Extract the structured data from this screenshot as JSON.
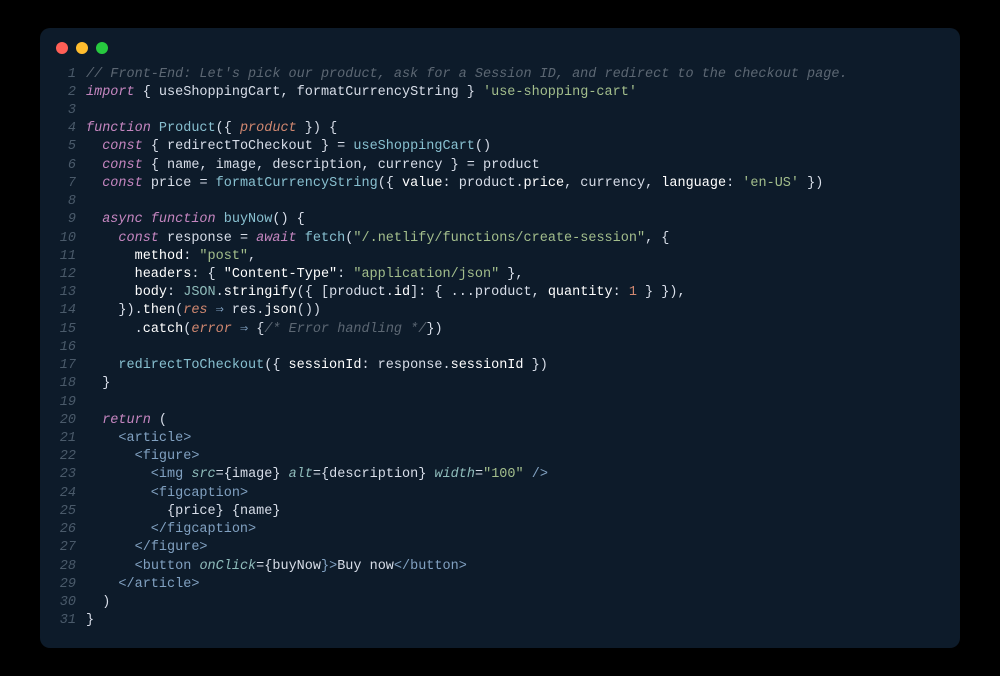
{
  "window": {
    "traffic_lights": [
      "close",
      "minimize",
      "zoom"
    ]
  },
  "code": {
    "lines": [
      {
        "n": 1,
        "tokens": [
          {
            "t": "// Front-End: Let's pick our product, ask for a Session ID, and redirect to the checkout page.",
            "c": "tok-comment"
          }
        ]
      },
      {
        "n": 2,
        "tokens": [
          {
            "t": "import",
            "c": "tok-keyword"
          },
          {
            "t": " { ",
            "c": "tok-punct"
          },
          {
            "t": "useShoppingCart",
            "c": "tok-var"
          },
          {
            "t": ", ",
            "c": "tok-punct"
          },
          {
            "t": "formatCurrencyString",
            "c": "tok-var"
          },
          {
            "t": " } ",
            "c": "tok-punct"
          },
          {
            "t": "'use-shopping-cart'",
            "c": "tok-string"
          }
        ]
      },
      {
        "n": 3,
        "tokens": []
      },
      {
        "n": 4,
        "tokens": [
          {
            "t": "function",
            "c": "tok-keyword"
          },
          {
            "t": " ",
            "c": ""
          },
          {
            "t": "Product",
            "c": "tok-func"
          },
          {
            "t": "({ ",
            "c": "tok-punct"
          },
          {
            "t": "product",
            "c": "tok-param"
          },
          {
            "t": " }) {",
            "c": "tok-punct"
          }
        ]
      },
      {
        "n": 5,
        "tokens": [
          {
            "t": "  ",
            "c": ""
          },
          {
            "t": "const",
            "c": "tok-keyword"
          },
          {
            "t": " { ",
            "c": "tok-punct"
          },
          {
            "t": "redirectToCheckout",
            "c": "tok-var"
          },
          {
            "t": " } = ",
            "c": "tok-punct"
          },
          {
            "t": "useShoppingCart",
            "c": "tok-func"
          },
          {
            "t": "()",
            "c": "tok-punct"
          }
        ]
      },
      {
        "n": 6,
        "tokens": [
          {
            "t": "  ",
            "c": ""
          },
          {
            "t": "const",
            "c": "tok-keyword"
          },
          {
            "t": " { ",
            "c": "tok-punct"
          },
          {
            "t": "name",
            "c": "tok-var"
          },
          {
            "t": ", ",
            "c": "tok-punct"
          },
          {
            "t": "image",
            "c": "tok-var"
          },
          {
            "t": ", ",
            "c": "tok-punct"
          },
          {
            "t": "description",
            "c": "tok-var"
          },
          {
            "t": ", ",
            "c": "tok-punct"
          },
          {
            "t": "currency",
            "c": "tok-var"
          },
          {
            "t": " } = ",
            "c": "tok-punct"
          },
          {
            "t": "product",
            "c": "tok-var"
          }
        ]
      },
      {
        "n": 7,
        "tokens": [
          {
            "t": "  ",
            "c": ""
          },
          {
            "t": "const",
            "c": "tok-keyword"
          },
          {
            "t": " ",
            "c": ""
          },
          {
            "t": "price",
            "c": "tok-var"
          },
          {
            "t": " = ",
            "c": "tok-punct"
          },
          {
            "t": "formatCurrencyString",
            "c": "tok-func"
          },
          {
            "t": "({ ",
            "c": "tok-punct"
          },
          {
            "t": "value",
            "c": "tok-white"
          },
          {
            "t": ": ",
            "c": "tok-punct"
          },
          {
            "t": "product",
            "c": "tok-var"
          },
          {
            "t": ".",
            "c": "tok-punct"
          },
          {
            "t": "price",
            "c": "tok-white"
          },
          {
            "t": ", ",
            "c": "tok-punct"
          },
          {
            "t": "currency",
            "c": "tok-var"
          },
          {
            "t": ", ",
            "c": "tok-punct"
          },
          {
            "t": "language",
            "c": "tok-white"
          },
          {
            "t": ": ",
            "c": "tok-punct"
          },
          {
            "t": "'en-US'",
            "c": "tok-string"
          },
          {
            "t": " })",
            "c": "tok-punct"
          }
        ]
      },
      {
        "n": 8,
        "tokens": []
      },
      {
        "n": 9,
        "tokens": [
          {
            "t": "  ",
            "c": ""
          },
          {
            "t": "async",
            "c": "tok-keyword"
          },
          {
            "t": " ",
            "c": ""
          },
          {
            "t": "function",
            "c": "tok-keyword"
          },
          {
            "t": " ",
            "c": ""
          },
          {
            "t": "buyNow",
            "c": "tok-func"
          },
          {
            "t": "() {",
            "c": "tok-punct"
          }
        ]
      },
      {
        "n": 10,
        "tokens": [
          {
            "t": "    ",
            "c": ""
          },
          {
            "t": "const",
            "c": "tok-keyword"
          },
          {
            "t": " ",
            "c": ""
          },
          {
            "t": "response",
            "c": "tok-var"
          },
          {
            "t": " = ",
            "c": "tok-punct"
          },
          {
            "t": "await",
            "c": "tok-keyword"
          },
          {
            "t": " ",
            "c": ""
          },
          {
            "t": "fetch",
            "c": "tok-func"
          },
          {
            "t": "(",
            "c": "tok-punct"
          },
          {
            "t": "\"/.netlify/functions/create-session\"",
            "c": "tok-string"
          },
          {
            "t": ", {",
            "c": "tok-punct"
          }
        ]
      },
      {
        "n": 11,
        "tokens": [
          {
            "t": "      ",
            "c": ""
          },
          {
            "t": "method",
            "c": "tok-white"
          },
          {
            "t": ": ",
            "c": "tok-punct"
          },
          {
            "t": "\"post\"",
            "c": "tok-string"
          },
          {
            "t": ",",
            "c": "tok-punct"
          }
        ]
      },
      {
        "n": 12,
        "tokens": [
          {
            "t": "      ",
            "c": ""
          },
          {
            "t": "headers",
            "c": "tok-white"
          },
          {
            "t": ": { ",
            "c": "tok-punct"
          },
          {
            "t": "\"Content-Type\"",
            "c": "tok-white"
          },
          {
            "t": ": ",
            "c": "tok-punct"
          },
          {
            "t": "\"application/json\"",
            "c": "tok-string"
          },
          {
            "t": " },",
            "c": "tok-punct"
          }
        ]
      },
      {
        "n": 13,
        "tokens": [
          {
            "t": "      ",
            "c": ""
          },
          {
            "t": "body",
            "c": "tok-white"
          },
          {
            "t": ": ",
            "c": "tok-punct"
          },
          {
            "t": "JSON",
            "c": "tok-type"
          },
          {
            "t": ".",
            "c": "tok-punct"
          },
          {
            "t": "stringify",
            "c": "tok-white"
          },
          {
            "t": "({ [",
            "c": "tok-punct"
          },
          {
            "t": "product",
            "c": "tok-var"
          },
          {
            "t": ".",
            "c": "tok-punct"
          },
          {
            "t": "id",
            "c": "tok-white"
          },
          {
            "t": "]: { ...",
            "c": "tok-punct"
          },
          {
            "t": "product",
            "c": "tok-var"
          },
          {
            "t": ", ",
            "c": "tok-punct"
          },
          {
            "t": "quantity",
            "c": "tok-white"
          },
          {
            "t": ": ",
            "c": "tok-punct"
          },
          {
            "t": "1",
            "c": "tok-number"
          },
          {
            "t": " } }),",
            "c": "tok-punct"
          }
        ]
      },
      {
        "n": 14,
        "tokens": [
          {
            "t": "    }).",
            "c": "tok-punct"
          },
          {
            "t": "then",
            "c": "tok-white"
          },
          {
            "t": "(",
            "c": "tok-punct"
          },
          {
            "t": "res",
            "c": "tok-param"
          },
          {
            "t": " ",
            "c": ""
          },
          {
            "t": "⇒",
            "c": "tok-operator"
          },
          {
            "t": " ",
            "c": ""
          },
          {
            "t": "res",
            "c": "tok-var"
          },
          {
            "t": ".",
            "c": "tok-punct"
          },
          {
            "t": "json",
            "c": "tok-white"
          },
          {
            "t": "())",
            "c": "tok-punct"
          }
        ]
      },
      {
        "n": 15,
        "tokens": [
          {
            "t": "      .",
            "c": "tok-punct"
          },
          {
            "t": "catch",
            "c": "tok-white"
          },
          {
            "t": "(",
            "c": "tok-punct"
          },
          {
            "t": "error",
            "c": "tok-param"
          },
          {
            "t": " ",
            "c": ""
          },
          {
            "t": "⇒",
            "c": "tok-operator"
          },
          {
            "t": " {",
            "c": "tok-punct"
          },
          {
            "t": "/* Error handling */",
            "c": "tok-comment"
          },
          {
            "t": "})",
            "c": "tok-punct"
          }
        ]
      },
      {
        "n": 16,
        "tokens": []
      },
      {
        "n": 17,
        "tokens": [
          {
            "t": "    ",
            "c": ""
          },
          {
            "t": "redirectToCheckout",
            "c": "tok-func"
          },
          {
            "t": "({ ",
            "c": "tok-punct"
          },
          {
            "t": "sessionId",
            "c": "tok-white"
          },
          {
            "t": ": ",
            "c": "tok-punct"
          },
          {
            "t": "response",
            "c": "tok-var"
          },
          {
            "t": ".",
            "c": "tok-punct"
          },
          {
            "t": "sessionId",
            "c": "tok-white"
          },
          {
            "t": " })",
            "c": "tok-punct"
          }
        ]
      },
      {
        "n": 18,
        "tokens": [
          {
            "t": "  }",
            "c": "tok-punct"
          }
        ]
      },
      {
        "n": 19,
        "tokens": []
      },
      {
        "n": 20,
        "tokens": [
          {
            "t": "  ",
            "c": ""
          },
          {
            "t": "return",
            "c": "tok-keyword"
          },
          {
            "t": " (",
            "c": "tok-punct"
          }
        ]
      },
      {
        "n": 21,
        "tokens": [
          {
            "t": "    <",
            "c": "tok-tag"
          },
          {
            "t": "article",
            "c": "tok-tag"
          },
          {
            "t": ">",
            "c": "tok-tag"
          }
        ]
      },
      {
        "n": 22,
        "tokens": [
          {
            "t": "      <",
            "c": "tok-tag"
          },
          {
            "t": "figure",
            "c": "tok-tag"
          },
          {
            "t": ">",
            "c": "tok-tag"
          }
        ]
      },
      {
        "n": 23,
        "tokens": [
          {
            "t": "        <",
            "c": "tok-tag"
          },
          {
            "t": "img",
            "c": "tok-tag"
          },
          {
            "t": " ",
            "c": ""
          },
          {
            "t": "src",
            "c": "tok-attr"
          },
          {
            "t": "=",
            "c": "tok-punct"
          },
          {
            "t": "{",
            "c": "tok-punct"
          },
          {
            "t": "image",
            "c": "tok-var"
          },
          {
            "t": "}",
            "c": "tok-punct"
          },
          {
            "t": " ",
            "c": ""
          },
          {
            "t": "alt",
            "c": "tok-attr"
          },
          {
            "t": "=",
            "c": "tok-punct"
          },
          {
            "t": "{",
            "c": "tok-punct"
          },
          {
            "t": "description",
            "c": "tok-var"
          },
          {
            "t": "}",
            "c": "tok-punct"
          },
          {
            "t": " ",
            "c": ""
          },
          {
            "t": "width",
            "c": "tok-attr"
          },
          {
            "t": "=",
            "c": "tok-punct"
          },
          {
            "t": "\"100\"",
            "c": "tok-string"
          },
          {
            "t": " />",
            "c": "tok-tag"
          }
        ]
      },
      {
        "n": 24,
        "tokens": [
          {
            "t": "        <",
            "c": "tok-tag"
          },
          {
            "t": "figcaption",
            "c": "tok-tag"
          },
          {
            "t": ">",
            "c": "tok-tag"
          }
        ]
      },
      {
        "n": 25,
        "tokens": [
          {
            "t": "          {",
            "c": "tok-punct"
          },
          {
            "t": "price",
            "c": "tok-var"
          },
          {
            "t": "} {",
            "c": "tok-punct"
          },
          {
            "t": "name",
            "c": "tok-var"
          },
          {
            "t": "}",
            "c": "tok-punct"
          }
        ]
      },
      {
        "n": 26,
        "tokens": [
          {
            "t": "        </",
            "c": "tok-tag"
          },
          {
            "t": "figcaption",
            "c": "tok-tag"
          },
          {
            "t": ">",
            "c": "tok-tag"
          }
        ]
      },
      {
        "n": 27,
        "tokens": [
          {
            "t": "      </",
            "c": "tok-tag"
          },
          {
            "t": "figure",
            "c": "tok-tag"
          },
          {
            "t": ">",
            "c": "tok-tag"
          }
        ]
      },
      {
        "n": 28,
        "tokens": [
          {
            "t": "      <",
            "c": "tok-tag"
          },
          {
            "t": "button",
            "c": "tok-tag"
          },
          {
            "t": " ",
            "c": ""
          },
          {
            "t": "onClick",
            "c": "tok-attr"
          },
          {
            "t": "=",
            "c": "tok-punct"
          },
          {
            "t": "{",
            "c": "tok-punct"
          },
          {
            "t": "buyNow",
            "c": "tok-var"
          },
          {
            "t": "}>",
            "c": "tok-tag"
          },
          {
            "t": "Buy now",
            "c": "tok-var"
          },
          {
            "t": "</",
            "c": "tok-tag"
          },
          {
            "t": "button",
            "c": "tok-tag"
          },
          {
            "t": ">",
            "c": "tok-tag"
          }
        ]
      },
      {
        "n": 29,
        "tokens": [
          {
            "t": "    </",
            "c": "tok-tag"
          },
          {
            "t": "article",
            "c": "tok-tag"
          },
          {
            "t": ">",
            "c": "tok-tag"
          }
        ]
      },
      {
        "n": 30,
        "tokens": [
          {
            "t": "  )",
            "c": "tok-punct"
          }
        ]
      },
      {
        "n": 31,
        "tokens": [
          {
            "t": "}",
            "c": "tok-punct"
          }
        ]
      }
    ]
  }
}
